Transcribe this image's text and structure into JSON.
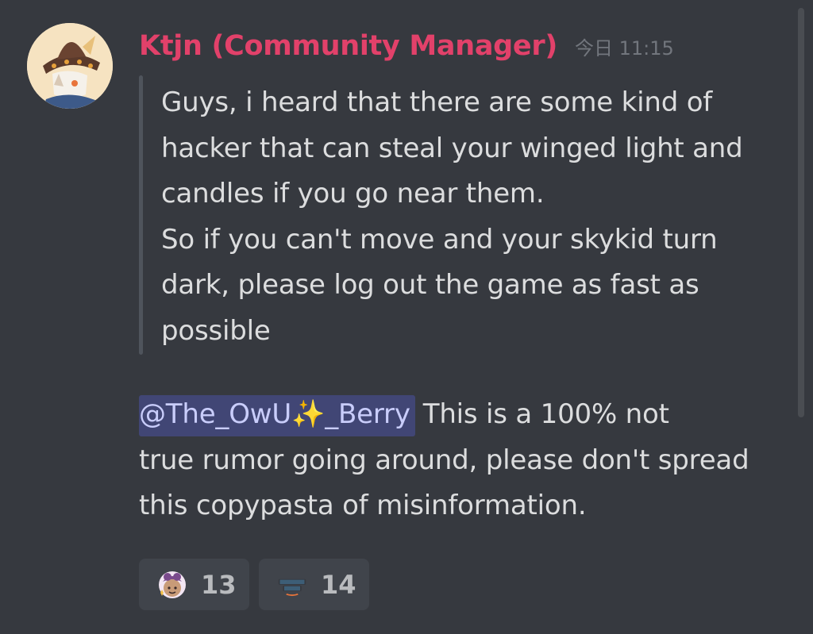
{
  "message": {
    "author": "Ktjn (Community Manager)",
    "author_color": "#e2416a",
    "timestamp": "今日 11:15",
    "avatar_icon": "witch-hat-character-avatar",
    "quote_lines": [
      "Guys, i heard that there are some kind of",
      "hacker that can steal your winged light and",
      "candles if you go near them.",
      "So if you can't move and your skykid turn",
      "dark, please log out the game as fast as",
      "possible"
    ],
    "mention": {
      "prefix": "@The_OwU",
      "sparkle": "✨",
      "suffix": "_Berry"
    },
    "reply_lines": [
      "This is a 100% not",
      "true rumor going around, please don't spread",
      "this copypasta of  misinformation."
    ]
  },
  "reactions": [
    {
      "emoji": "ok-sticker-emoji",
      "count": "13"
    },
    {
      "emoji": "thank-you-sticker-emoji",
      "count": "14"
    }
  ],
  "colors": {
    "background": "#36393f",
    "text": "#dcddde",
    "mention_bg": "#414675",
    "reaction_bg": "#40444b"
  }
}
